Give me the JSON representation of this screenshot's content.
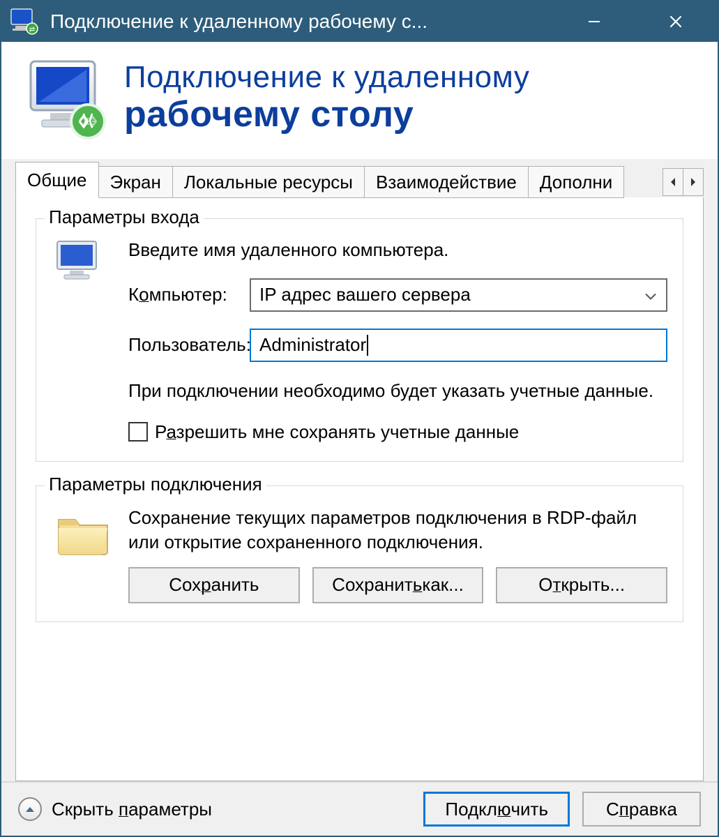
{
  "titlebar": {
    "text": "Подключение к удаленному рабочему с..."
  },
  "header": {
    "line1": "Подключение к удаленному",
    "line2": "рабочему столу"
  },
  "tabs": [
    {
      "label": "Общие",
      "active": true
    },
    {
      "label": "Экран"
    },
    {
      "label": "Локальные ресурсы"
    },
    {
      "label": "Взаимодействие"
    },
    {
      "label": "Дополни"
    }
  ],
  "login_group": {
    "title": "Параметры входа",
    "intro": "Введите имя удаленного компьютера.",
    "computer_label_pre": "К",
    "computer_label_u": "о",
    "computer_label_post": "мпьютер:",
    "computer_value": "IP адрес вашего сервера",
    "user_label": "Пользователь:",
    "user_value": "Administrator",
    "note": "При подключении необходимо будет указать учетные данные.",
    "checkbox_pre": "Р",
    "checkbox_u": "а",
    "checkbox_post": "зрешить мне сохранять учетные данные"
  },
  "conn_group": {
    "title": "Параметры подключения",
    "text": "Сохранение текущих параметров подключения в RDP-файл или открытие сохраненного подключения.",
    "save_pre": "Сох",
    "save_u": "р",
    "save_post": "анить",
    "saveas_pre": "Сохранит",
    "saveas_u": "ь",
    "saveas_post": " как...",
    "open_pre": "О",
    "open_u": "т",
    "open_post": "крыть..."
  },
  "footer": {
    "collapse_pre": "Скрыть ",
    "collapse_u": "п",
    "collapse_post": "араметры",
    "connect_pre": "Подкл",
    "connect_u": "ю",
    "connect_post": "чить",
    "help_pre": "С",
    "help_u": "п",
    "help_post": "равка"
  }
}
